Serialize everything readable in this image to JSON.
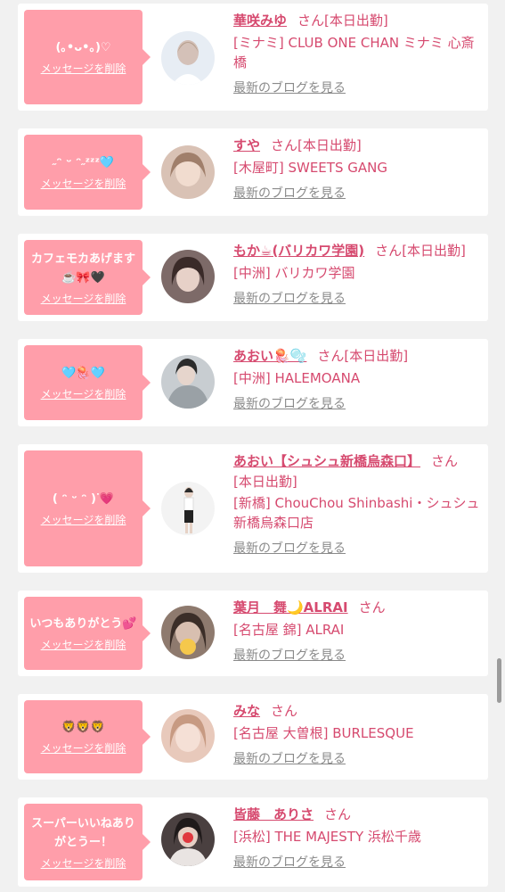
{
  "delete_label": "メッセージを削除",
  "blog_label": "最新のブログを見る",
  "san": "さん",
  "cards": [
    {
      "message": "(｡•ᴗ•｡)♡",
      "name": "華咲みゆ",
      "san_suffix": "[本日出勤]",
      "shop": "[ミナミ] CLUB ONE CHAN ミナミ 心斎橋",
      "avatar_color": "#e7edf4"
    },
    {
      "message": "˶ᵔ ᵕ ᵔ˶ᶻᶻᶻ🩵",
      "name": "すや",
      "san_suffix": "[本日出勤]",
      "shop": "[木屋町] SWEETS GANG",
      "avatar_color": "#d9c2b5"
    },
    {
      "message": "カフェモカあげます☕️🎀🖤",
      "name": "もか☕(バリカワ学園)",
      "san_suffix": "[本日出勤]",
      "shop": "[中洲] バリカワ学園",
      "avatar_color": "#7d6a68"
    },
    {
      "message": "🩵🪼🩵",
      "name": "あおい🪼🫧",
      "san_suffix": "[本日出勤]",
      "shop": "[中洲] HALEMOANA",
      "avatar_color": "#9aa1a6"
    },
    {
      "message": "( ᵔ ᵕ ᵔ )ᐝ💗",
      "name": "あおい【シュシュ新橋烏森口】",
      "san_suffix": "",
      "shift": "[本日出勤]",
      "shop": "[新橋] ChouChou Shinbashi・シュシュ新橋烏森口店",
      "avatar_color": "#f3f3f3"
    },
    {
      "message": "いつもありがとう💕",
      "name": "葉月　舞🌙ALRAI",
      "san_suffix": "",
      "shop": "[名古屋 錦] ALRAI",
      "avatar_color": "#8e7a6e"
    },
    {
      "message": "🦁🦁🦁",
      "name": "みな",
      "san_suffix": "",
      "shop": "[名古屋 大曽根] BURLESQUE",
      "avatar_color": "#e8c9bb"
    },
    {
      "message": "スーパーいいねありがとうー！",
      "name": "皆藤　ありさ",
      "san_suffix": "",
      "shop": "[浜松] THE MAJESTY 浜松千歳",
      "avatar_color": "#4a4040"
    }
  ]
}
